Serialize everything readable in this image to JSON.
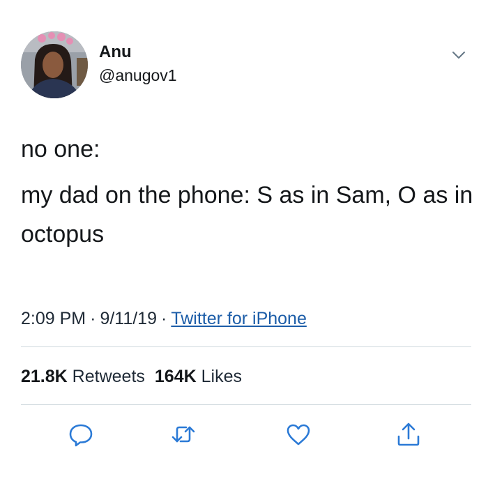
{
  "author": {
    "name": "Anu",
    "handle": "@anugov1",
    "avatar_icon": "profile-photo"
  },
  "tweet": {
    "lines": [
      "no one:",
      "my dad on the phone: S as in Sam, O as in octopus"
    ]
  },
  "meta": {
    "time": "2:09 PM",
    "date": "9/11/19",
    "source": "Twitter for iPhone",
    "separator": "·"
  },
  "stats": {
    "retweets_count": "21.8K",
    "retweets_label": "Retweets",
    "likes_count": "164K",
    "likes_label": "Likes"
  },
  "actions": [
    "reply-icon",
    "retweet-icon",
    "like-icon",
    "share-icon"
  ],
  "colors": {
    "text": "#14171a",
    "link": "#1c5da8",
    "icon": "#2b7ad6",
    "divider": "#cfd9de"
  }
}
